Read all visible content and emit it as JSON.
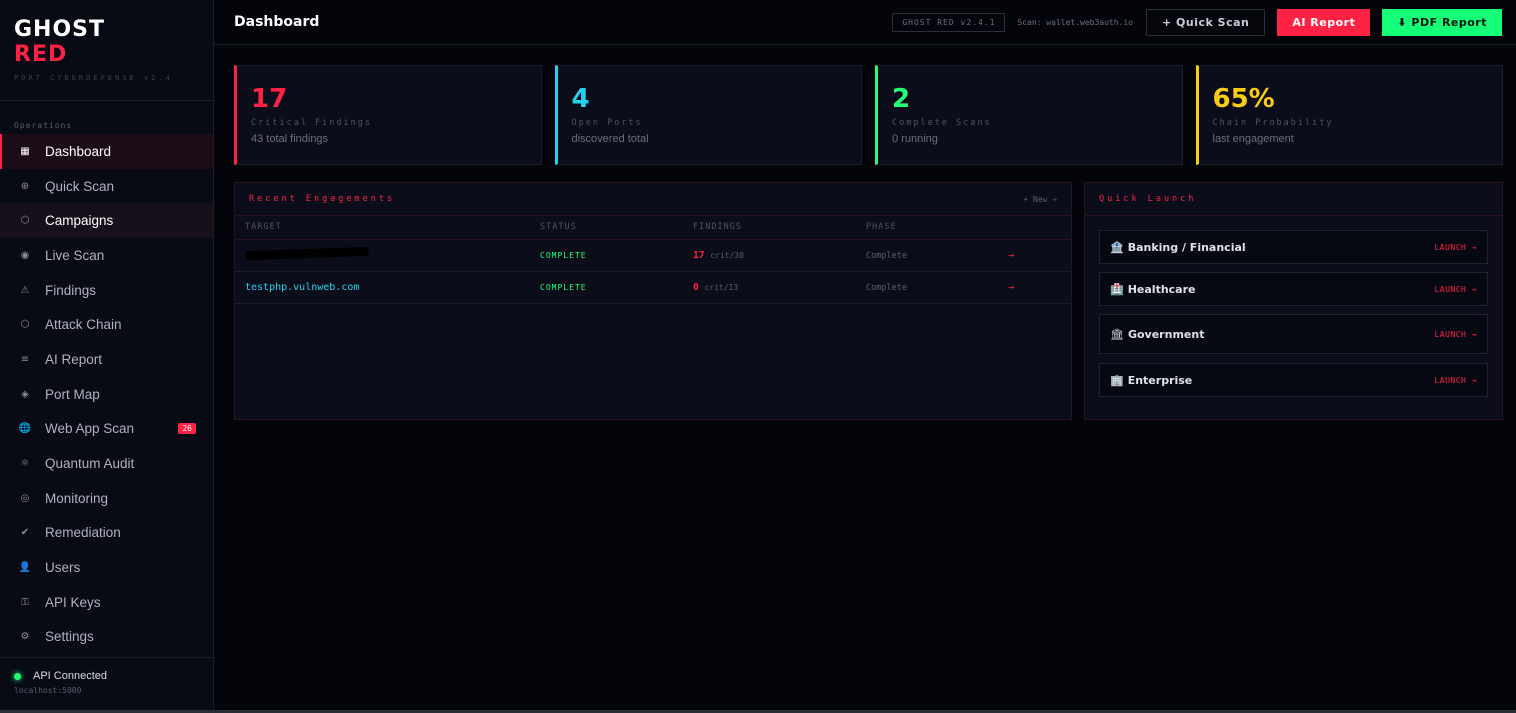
{
  "brand": {
    "line1": "GHOST",
    "line2": "RED",
    "sub": "PORT CYBERDEFENSE v2.4"
  },
  "sidebar": {
    "section": "Operations",
    "items": [
      {
        "icon": "▦",
        "label": "Dashboard",
        "name": "dashboard"
      },
      {
        "icon": "⊕",
        "label": "Quick Scan",
        "name": "quick-scan"
      },
      {
        "icon": "⬡",
        "label": "Campaigns",
        "name": "campaigns"
      },
      {
        "icon": "◉",
        "label": "Live Scan",
        "name": "live-scan"
      },
      {
        "icon": "⚠",
        "label": "Findings",
        "name": "findings"
      },
      {
        "icon": "⬡",
        "label": "Attack Chain",
        "name": "attack-chain"
      },
      {
        "icon": "≡",
        "label": "AI Report",
        "name": "ai-report"
      },
      {
        "icon": "◈",
        "label": "Port Map",
        "name": "port-map"
      },
      {
        "icon": "🌐",
        "label": "Web App Scan",
        "name": "web-app-scan",
        "badge": "26"
      },
      {
        "icon": "⚛",
        "label": "Quantum Audit",
        "name": "quantum-audit"
      },
      {
        "icon": "◎",
        "label": "Monitoring",
        "name": "monitoring"
      },
      {
        "icon": "✔",
        "label": "Remediation",
        "name": "remediation"
      },
      {
        "icon": "👤",
        "label": "Users",
        "name": "users"
      },
      {
        "icon": "⚿",
        "label": "API Keys",
        "name": "api-keys"
      },
      {
        "icon": "⚙",
        "label": "Settings",
        "name": "settings"
      }
    ],
    "footer": {
      "status": "API Connected",
      "host": "localhost:5000"
    }
  },
  "header": {
    "title": "Dashboard",
    "version": "GHOST RED v2.4.1",
    "scan": "Scan: wallet.web3auth.io",
    "quick_scan": "+ Quick Scan",
    "ai_report": "AI Report",
    "pdf_report": "⬇ PDF Report"
  },
  "stats": [
    {
      "value": "17",
      "label": "Critical Findings",
      "sub": "43 total findings",
      "color": "#ff2244"
    },
    {
      "value": "4",
      "label": "Open Ports",
      "sub": "discovered total",
      "color": "#22d3ee"
    },
    {
      "value": "2",
      "label": "Complete Scans",
      "sub": "0 running",
      "color": "#22ff77"
    },
    {
      "value": "65%",
      "label": "Chain Probability",
      "sub": "last engagement",
      "color": "#facc15"
    }
  ],
  "engagements": {
    "title": "Recent Engagements",
    "action": "+ New →",
    "columns": {
      "target": "TARGET",
      "status": "STATUS",
      "findings": "FINDINGS",
      "phase": "PHASE"
    },
    "rows": [
      {
        "target": "",
        "status": "COMPLETE",
        "crit": "17",
        "crit_sub": "crit/30",
        "phase": "Complete",
        "arrow": "→"
      },
      {
        "target": "testphp.vulnweb.com",
        "status": "COMPLETE",
        "crit": "0",
        "crit_sub": "crit/13",
        "phase": "Complete",
        "arrow": "→"
      }
    ]
  },
  "quick_launch": {
    "title": "Quick Launch",
    "items": [
      {
        "icon": "🏦",
        "label": "Banking / Financial",
        "action": "LAUNCH →"
      },
      {
        "icon": "🏥",
        "label": "Healthcare",
        "action": "LAUNCH →"
      },
      {
        "icon": "🏛",
        "label": "Government",
        "action": "LAUNCH →"
      },
      {
        "icon": "🏢",
        "label": "Enterprise",
        "action": "LAUNCH →"
      }
    ]
  }
}
